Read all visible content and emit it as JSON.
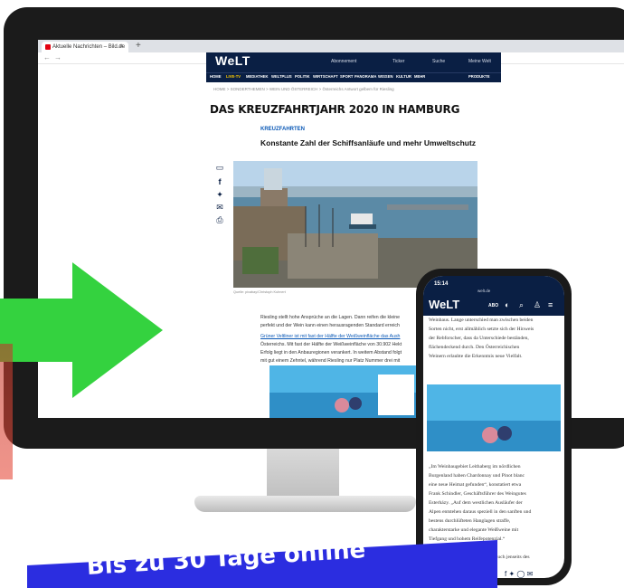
{
  "browser": {
    "tab_title": "Aktuelle Nachrichten – Bild.de",
    "close": "×",
    "new_tab": "+",
    "back": "←",
    "forward": "→"
  },
  "welt": {
    "logo": "WeLT",
    "header_links": [
      "Abonnement",
      "Ticker",
      "Suche",
      "Meine Welt"
    ],
    "nav": [
      "HOME",
      "LIVE-TV",
      "MEDIATHEK",
      "WELTPLUS",
      "POLITIK",
      "WIRTSCHAFT",
      "SPORT",
      "PANORAMA",
      "WISSEN",
      "KULTUR",
      "MEHR",
      "PRODUKTE"
    ],
    "breadcrumb": "HOME > SONDERTHEMEN > WEIN UND ÖSTERREICH > Österreichs Antwort gelbem für Riesling",
    "section_title": "DAS KREUZFAHRTJAHR 2020 IN HAMBURG",
    "kicker": "KREUZFAHRTEN",
    "headline": "Konstante Zahl der Schiffsanläufe und mehr Umweltschutz",
    "caption": "Quelle: pixabay/Christoph Kuhnert",
    "body": [
      "Riesling stellt hohe Ansprüche an die Lagen. Dann reifen die kleine",
      "perfekt und der Wein kann einen herausragenden Standard erreich",
      "Grüner Veltliner ist mit fast der Hälfte der Weißweinfläche das Aush",
      "Österreichs. Mit fast der Hälfte der Weißweinfläche von 30.902 Hekt",
      "Erfolg liegt in den Anbauregionen verankert. In weitem Abstand folgt",
      "mit gut einem Zehntel, während Riesling nur Platz Nummer drei mit"
    ]
  },
  "phone": {
    "time": "15:14",
    "url": "welt.de",
    "logo": "WeLT",
    "abo": "ABO",
    "text_top": [
      "Weinbaus. Lange unterschied man zwischen beiden",
      "Sorten nicht, erst allmählich setzte sich der Hinweis",
      "der Rebforscher, dass da Unterschiede beständen,",
      "flächendeckend durch. Den Österreichischen",
      "Weinern erlaubte die Erkenntnis neue Vielfalt."
    ],
    "text_bottom": [
      "„Im Weinbaugebiet Leithaberg im nördlichen",
      "Burgenland haben Chardonnay und Pinot blanc",
      "eine neue Heimat gefunden“, konstatiert etwa",
      "Frank Schindler, Geschäftsführer des Weingutes",
      "Esterházy. „Auf dem westlichen Ausläufer der",
      "Alpen entstehen daraus speziell in den sanften und",
      "bestens durchlüfteten Hanglagen straffe,",
      "charakterstarke und elegante Weißweine mit",
      "Tiefgang und hohem Reifepotenzial.“",
      "",
      "Sie zu überleben, fällt allerdings auch jenseits des"
    ]
  },
  "banner": {
    "text": "Bis zu 30 Tage online",
    "color": "#2b2de0"
  },
  "colors": {
    "welt_navy": "#0a1f44",
    "arrow_green": "#34d23f"
  }
}
